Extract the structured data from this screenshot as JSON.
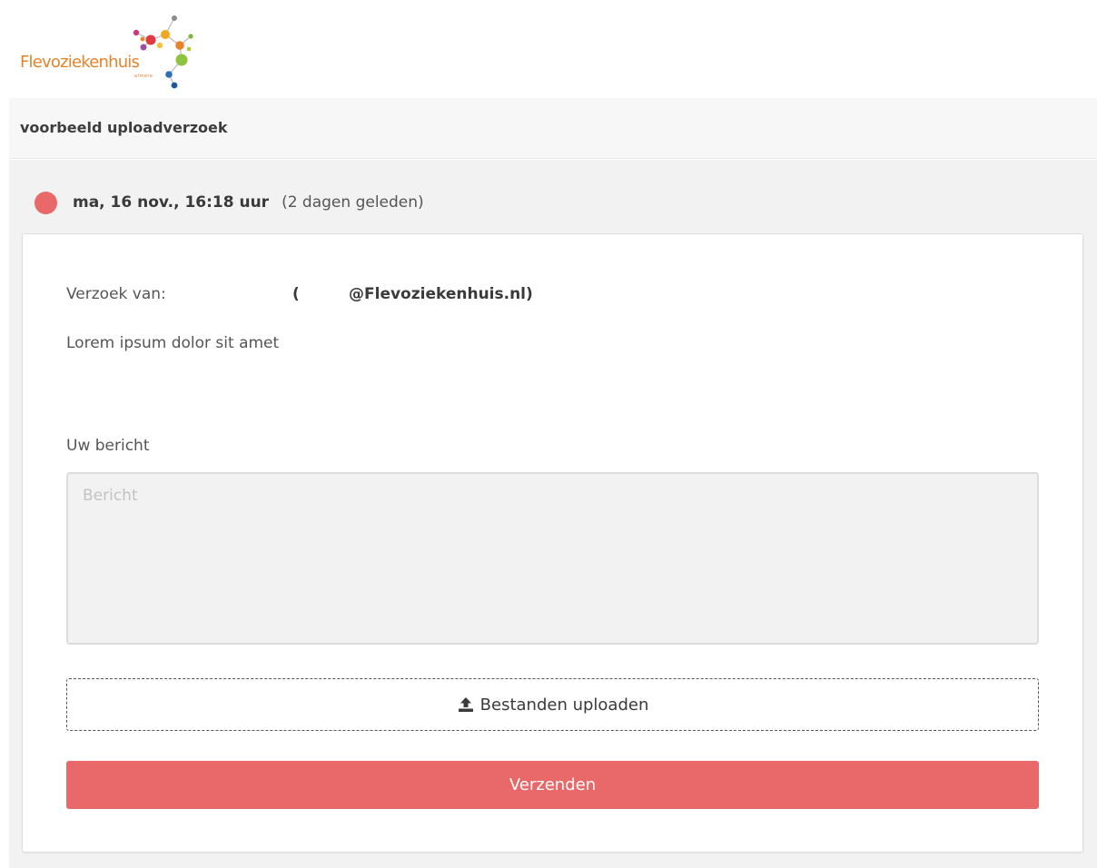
{
  "brand": {
    "logo_text": "Flevoziekenhuis",
    "logo_subtext": "almere"
  },
  "header": {
    "title": "voorbeeld uploadverzoek"
  },
  "status": {
    "date": "ma, 16 nov., 16:18 uur",
    "ago": "(2 dagen geleden)",
    "dot_color": "#e9686a"
  },
  "request": {
    "label": "Verzoek van:",
    "paren_open": "(",
    "email": "@Flevoziekenhuis.nl)",
    "description": "Lorem ipsum dolor sit amet"
  },
  "message": {
    "label": "Uw bericht",
    "placeholder": "Bericht",
    "value": ""
  },
  "upload": {
    "icon": "upload-icon",
    "label": "Bestanden uploaden"
  },
  "send": {
    "label": "Verzenden",
    "color": "#e9686a"
  }
}
